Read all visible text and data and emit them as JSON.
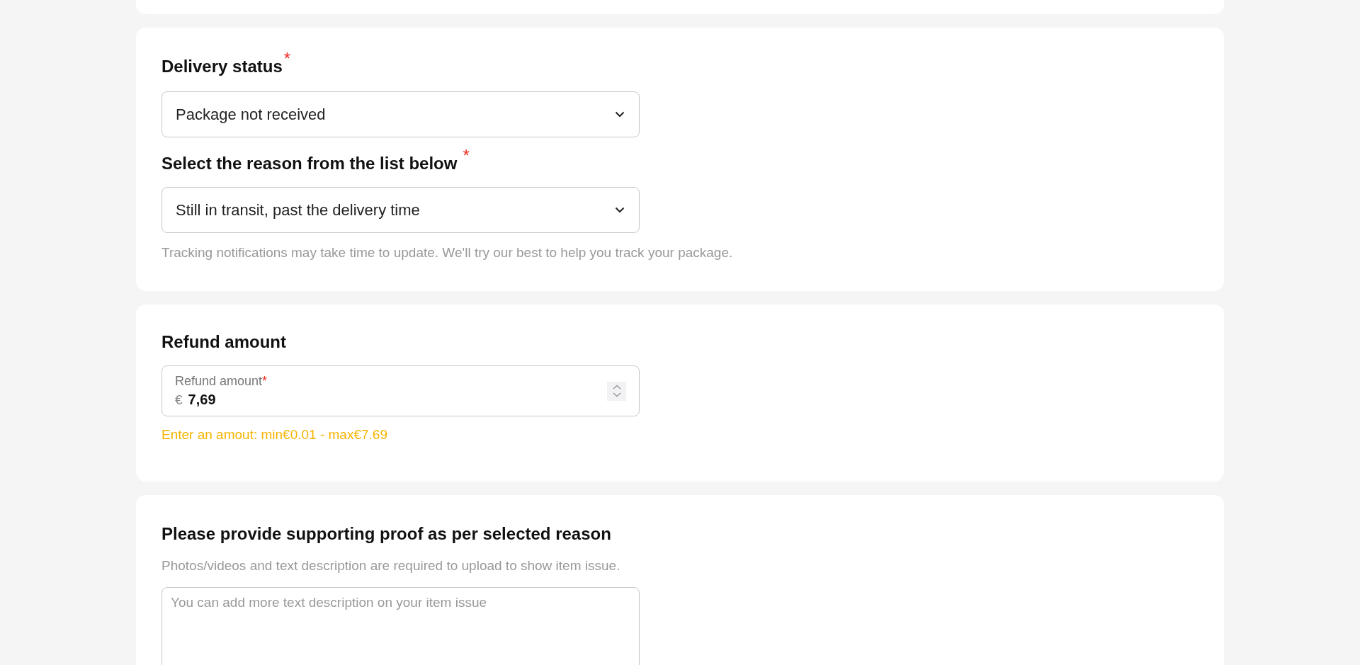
{
  "delivery_card": {
    "status_label": {
      "text": "Delivery status",
      "required_mark": "*"
    },
    "status_select": {
      "value": "Package not received"
    },
    "reason_label": {
      "text": "Select the reason from the list below",
      "required_mark": "*"
    },
    "reason_select": {
      "value": "Still in transit, past the delivery time"
    },
    "hint": "Tracking notifications may take time to update. We'll try our best to help you track your package."
  },
  "refund_card": {
    "title": "Refund amount",
    "amount_field": {
      "label": "Refund amount",
      "required_mark": "*",
      "currency": "€",
      "value": "7,69"
    },
    "warning": "Enter an amout: min€0.01 - max€7.69"
  },
  "proof_card": {
    "title": "Please provide supporting proof as per selected reason",
    "hint": "Photos/videos and text description are required to upload to show item issue.",
    "description_field": {
      "placeholder": "You can add more text description on your item issue"
    }
  }
}
